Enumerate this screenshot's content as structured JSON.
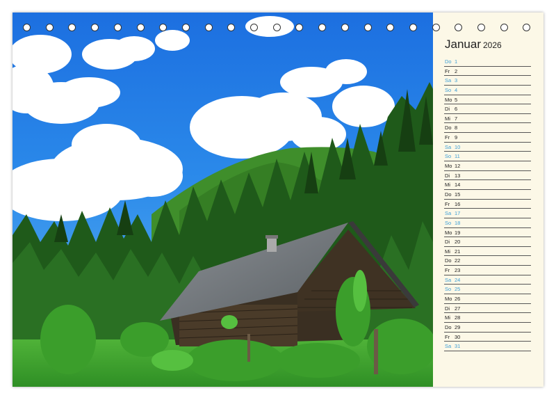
{
  "calendar": {
    "month": "Januar",
    "year": "2026",
    "weekend_color": "#3d9fd6",
    "days": [
      {
        "abbr": "Do",
        "num": "1",
        "weekend": true
      },
      {
        "abbr": "Fr",
        "num": "2",
        "weekend": false
      },
      {
        "abbr": "Sa",
        "num": "3",
        "weekend": true
      },
      {
        "abbr": "So",
        "num": "4",
        "weekend": true
      },
      {
        "abbr": "Mo",
        "num": "5",
        "weekend": false
      },
      {
        "abbr": "Di",
        "num": "6",
        "weekend": false
      },
      {
        "abbr": "Mi",
        "num": "7",
        "weekend": false
      },
      {
        "abbr": "Do",
        "num": "8",
        "weekend": false
      },
      {
        "abbr": "Fr",
        "num": "9",
        "weekend": false
      },
      {
        "abbr": "Sa",
        "num": "10",
        "weekend": true
      },
      {
        "abbr": "So",
        "num": "11",
        "weekend": true
      },
      {
        "abbr": "Mo",
        "num": "12",
        "weekend": false
      },
      {
        "abbr": "Di",
        "num": "13",
        "weekend": false
      },
      {
        "abbr": "Mi",
        "num": "14",
        "weekend": false
      },
      {
        "abbr": "Do",
        "num": "15",
        "weekend": false
      },
      {
        "abbr": "Fr",
        "num": "16",
        "weekend": false
      },
      {
        "abbr": "Sa",
        "num": "17",
        "weekend": true
      },
      {
        "abbr": "So",
        "num": "18",
        "weekend": true
      },
      {
        "abbr": "Mo",
        "num": "19",
        "weekend": false
      },
      {
        "abbr": "Di",
        "num": "20",
        "weekend": false
      },
      {
        "abbr": "Mi",
        "num": "21",
        "weekend": false
      },
      {
        "abbr": "Do",
        "num": "22",
        "weekend": false
      },
      {
        "abbr": "Fr",
        "num": "23",
        "weekend": false
      },
      {
        "abbr": "Sa",
        "num": "24",
        "weekend": true
      },
      {
        "abbr": "So",
        "num": "25",
        "weekend": true
      },
      {
        "abbr": "Mo",
        "num": "26",
        "weekend": false
      },
      {
        "abbr": "Di",
        "num": "27",
        "weekend": false
      },
      {
        "abbr": "Mi",
        "num": "28",
        "weekend": false
      },
      {
        "abbr": "Do",
        "num": "29",
        "weekend": false
      },
      {
        "abbr": "Fr",
        "num": "30",
        "weekend": false
      },
      {
        "abbr": "Sa",
        "num": "31",
        "weekend": true
      }
    ]
  },
  "binding": {
    "ring_count": 23
  },
  "photo": {
    "subject": "wooden-hut-in-forest"
  }
}
